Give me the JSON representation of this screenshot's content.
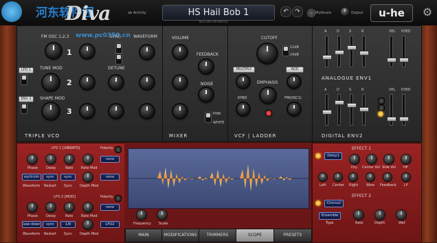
{
  "topbar": {
    "logo": "Diva",
    "activity_label": "ab Activity",
    "preset_name": "HS Hail Bob 1",
    "undo_icon": "↶",
    "redo_icon": "↷",
    "multicore_label": "Multicore",
    "output_label": "Output",
    "brand": "u-he",
    "subinfo": "NCH 4RFI    All    Mad-03"
  },
  "oscillator": {
    "title": "TRIPLE VCO",
    "labels": {
      "tune": "FM OSC 1,2,3",
      "sync": "SYNC",
      "waveform": "WAVEFORM",
      "tune_mod": "TUNE MOD",
      "detune": "DETUNE",
      "shape_mod": "SHAPE MOD",
      "lfo1": "LFO 1",
      "env2": "ENV 2"
    },
    "osc_numbers": [
      "1",
      "2",
      "3"
    ]
  },
  "mixer": {
    "title": "MIXER",
    "volume": "VOLUME",
    "feedback": "FEEDBACK",
    "noise": "NOISE",
    "pink": "PINK",
    "white": "WHITE"
  },
  "filter": {
    "title": "VCF | LADDER",
    "cutoff": "CUTOFF",
    "db12": "12dB",
    "db24": "24dB",
    "multiply": "MULTIPLY",
    "add": "ADD",
    "emphasis": "EMPHASIS",
    "kybd": "KYBD",
    "fm_osc1": "FM(OSC1)"
  },
  "envelopes": {
    "env1_title": "ANALOGUE ENV1",
    "env2_title": "DIGITAL ENV2",
    "adsr": [
      "A",
      "D",
      "S",
      "R"
    ],
    "vel": "VEL",
    "kybd": "KYBD"
  },
  "lfo1": {
    "title": "LFO 1 [VIBRATO]",
    "polarity": "Polarity",
    "knobs": [
      "Phase",
      "Delay",
      "Rate",
      "Rate Mod"
    ],
    "selectors": [
      "sqr/tri/sh",
      "sync",
      "sync"
    ],
    "selector_labels": [
      "Waveform",
      "Restart",
      "Sync",
      "Depth Mod"
    ],
    "none_top": "none",
    "none_bottom": "none"
  },
  "lfo2": {
    "title": "LFO 2 [MOD]",
    "polarity": "Polarity",
    "knobs": [
      "Phase",
      "Delay",
      "Rate",
      "Rate Mod"
    ],
    "selectors": [
      "saw down",
      "sync",
      "1/8"
    ],
    "selector_labels": [
      "Waveform",
      "Restart",
      "Sync",
      "Depth Mod"
    ],
    "none_top": "none",
    "lfo_btn": "LFO2"
  },
  "scope": {
    "frequency": "Frequency",
    "scale": "Scale"
  },
  "effect1": {
    "title": "EFFECT 1",
    "type": "Delay1",
    "knobs_top": [
      "Dry",
      "Center Vol",
      "Side Vol",
      "HP"
    ],
    "knobs_bottom": [
      "Left",
      "Center",
      "Right",
      "Wow",
      "Feedback",
      "LP"
    ]
  },
  "effect2": {
    "title": "EFFECT 2",
    "type": "Chorus2",
    "mode": "Ensemble",
    "type_label": "Type",
    "knobs": [
      "Rate",
      "Depth",
      "Wet"
    ]
  },
  "tabs": [
    "MAIN",
    "MODIFICATIONS",
    "TRIMMERS",
    "SCOPE",
    "PRESETS"
  ],
  "active_tab": "SCOPE",
  "watermark": {
    "line1": "河东软件园",
    "line2": "www.pc0359.cn"
  },
  "colors": {
    "panel_red": "#8a1c1c",
    "scope_blue": "#4a5a8a",
    "led_amber": "#ffb000"
  }
}
